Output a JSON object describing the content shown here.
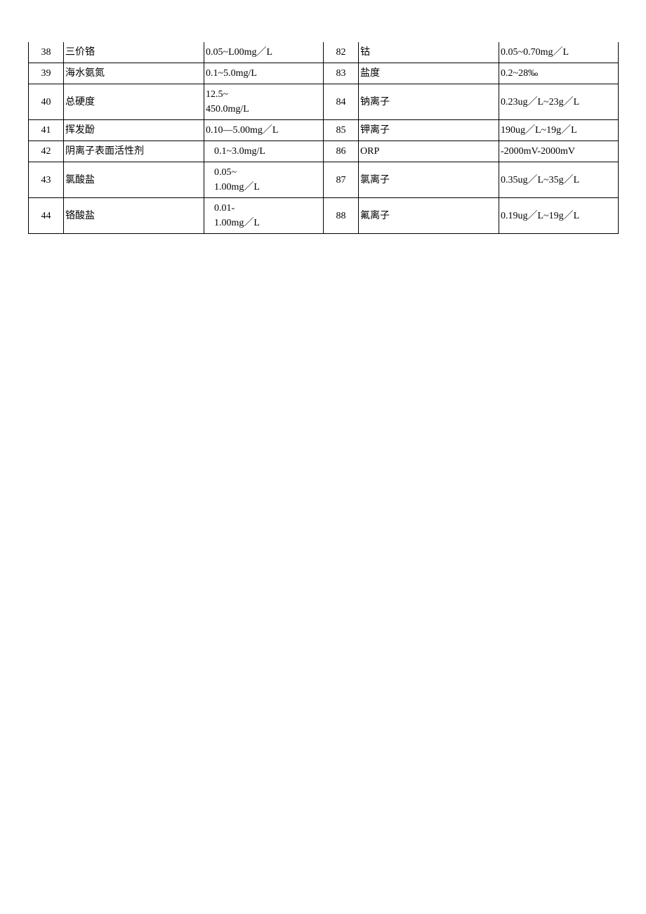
{
  "table": {
    "rows": [
      {
        "leftIdx": "38",
        "leftName": "三价铬",
        "leftVal": "0.05~L00mg／L",
        "leftIndent": false,
        "rightIdx": "82",
        "rightName": "钴",
        "rightVal": "0.05~0.70mg／L"
      },
      {
        "leftIdx": "39",
        "leftName": "海水氨氮",
        "leftVal": "0.1~5.0mg/L",
        "leftIndent": false,
        "rightIdx": "83",
        "rightName": "盐度",
        "rightVal": "0.2~28‰"
      },
      {
        "leftIdx": "40",
        "leftName": "总硬度",
        "leftVal": "12.5~\n450.0mg/L",
        "leftIndent": false,
        "rightIdx": "84",
        "rightName": "钠离子",
        "rightVal": "0.23ug／L~23g／L"
      },
      {
        "leftIdx": "41",
        "leftName": "挥发酚",
        "leftVal": "0.10—5.00mg／L",
        "leftIndent": false,
        "rightIdx": "85",
        "rightName": "钾离子",
        "rightVal": "190ug／L~19g／L"
      },
      {
        "leftIdx": "42",
        "leftName": "阴离子表面活性剂",
        "leftVal": "0.1~3.0mg/L",
        "leftIndent": true,
        "rightIdx": "86",
        "rightName": "ORP",
        "rightVal": "-2000mV-2000mV"
      },
      {
        "leftIdx": "43",
        "leftName": "氯酸盐",
        "leftVal": "0.05~\n1.00mg／L",
        "leftIndent": true,
        "rightIdx": "87",
        "rightName": "氯离子",
        "rightVal": "0.35ug／L~35g／L"
      },
      {
        "leftIdx": "44",
        "leftName": "铬酸盐",
        "leftVal": "0.01-\n1.00mg／L",
        "leftIndent": true,
        "rightIdx": "88",
        "rightName": "氟离子",
        "rightVal": "0.19ug／L~19g／L"
      }
    ]
  }
}
